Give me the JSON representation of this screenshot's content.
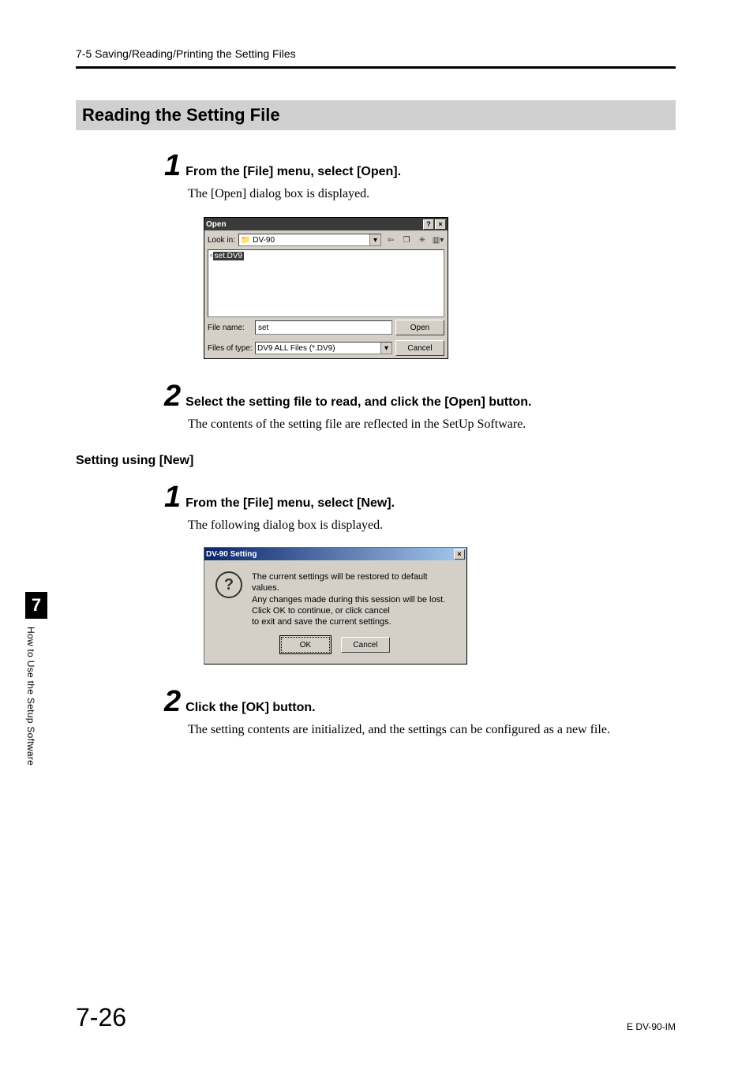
{
  "header": {
    "running_head": "7-5  Saving/Reading/Printing the Setting Files"
  },
  "section": {
    "title": "Reading the Setting File"
  },
  "steps_a": {
    "s1": {
      "num": "1",
      "instr": "From the [File] menu, select [Open].",
      "body": "The [Open] dialog box is displayed."
    },
    "s2": {
      "num": "2",
      "instr": "Select the setting file to read, and click the [Open] button.",
      "body": "The contents of the setting file are reflected in the SetUp Software."
    }
  },
  "subhead": "Setting using [New]",
  "steps_b": {
    "s1": {
      "num": "1",
      "instr": "From the [File] menu, select [New].",
      "body": "The following dialog box is displayed."
    },
    "s2": {
      "num": "2",
      "instr": "Click the [OK] button.",
      "body": "The setting contents are initialized, and the settings can be configured as a new file."
    }
  },
  "open_dialog": {
    "title": "Open",
    "help": "?",
    "close": "×",
    "look_in_label": "Look in:",
    "look_in_value": "DV-90",
    "file_selected": "set.DV9",
    "file_name_label": "File name:",
    "file_name_value": "set",
    "type_label": "Files of type:",
    "type_value": "DV9 ALL Files (*.DV9)",
    "open_btn": "Open",
    "cancel_btn": "Cancel"
  },
  "confirm_dialog": {
    "title": "DV-90 Setting",
    "close": "×",
    "msg_l1": "The current settings will be restored to default values.",
    "msg_l2": "Any changes made during this session will be lost.",
    "msg_l3": "Click OK to continue, or click cancel",
    "msg_l4": "to exit and save the current settings.",
    "ok": "OK",
    "cancel": "Cancel"
  },
  "side": {
    "num": "7",
    "text": "How to Use the Setup Software"
  },
  "footer": {
    "page": "7-26",
    "code": "E DV-90-IM"
  }
}
